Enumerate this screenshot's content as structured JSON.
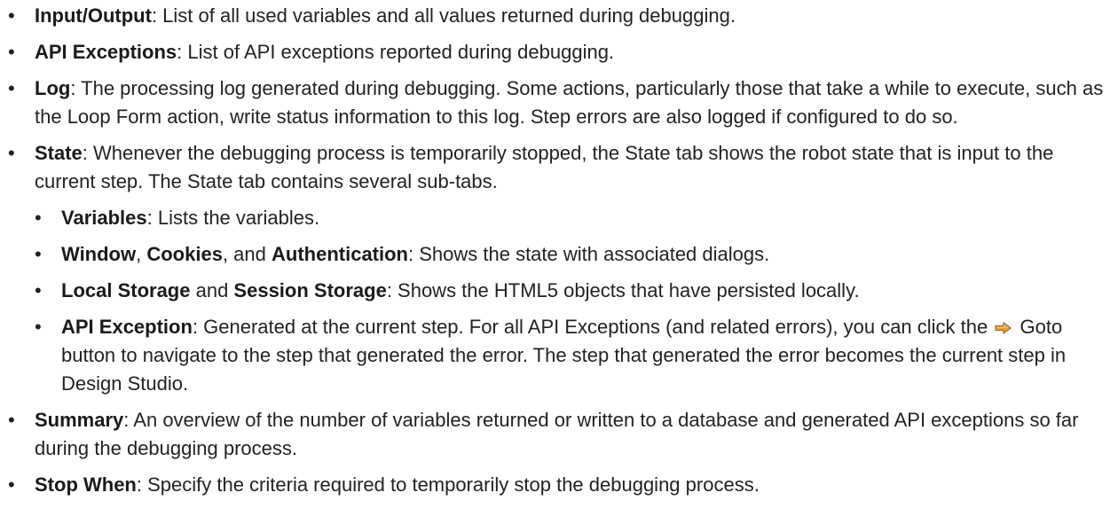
{
  "items": [
    {
      "term": "Input/Output",
      "text": ": List of all used variables and all values returned during debugging."
    },
    {
      "term": "API Exceptions",
      "text": ": List of API exceptions reported during debugging."
    },
    {
      "term": "Log",
      "text": ": The processing log generated during debugging. Some actions, particularly those that take a while to execute, such as the Loop Form action, write status information to this log. Step errors are also logged if configured to do so."
    },
    {
      "term": "State",
      "text": ": Whenever the debugging process is temporarily stopped, the State tab shows the robot state that is input to the current step. The State tab contains several sub-tabs.",
      "subitems": {
        "variables": {
          "term": "Variables",
          "text": ": Lists the variables."
        },
        "window": {
          "term1": "Window",
          "sep1": ", ",
          "term2": "Cookies",
          "sep2": ", and ",
          "term3": "Authentication",
          "text": ": Shows the state with associated dialogs."
        },
        "storage": {
          "term1": "Local Storage",
          "sep1": " and ",
          "term2": "Session Storage",
          "text": ": Shows the HTML5 objects that have persisted locally."
        },
        "api_exception": {
          "term": "API Exception",
          "text_before": ": Generated at the current step. For all API Exceptions (and related errors), you can click the ",
          "icon": "goto-icon",
          "text_after": " Goto button to navigate to the step that generated the error. The step that generated the error becomes the current step in Design Studio."
        }
      }
    },
    {
      "term": "Summary",
      "text": ": An overview of the number of variables returned or written to a database and generated API exceptions so far during the debugging process."
    },
    {
      "term": "Stop When",
      "text": ": Specify the criteria required to temporarily stop the debugging process."
    }
  ],
  "colors": {
    "text": "#222222",
    "icon_arrow": "#e8a33a",
    "icon_outline": "#9a6a1c"
  }
}
